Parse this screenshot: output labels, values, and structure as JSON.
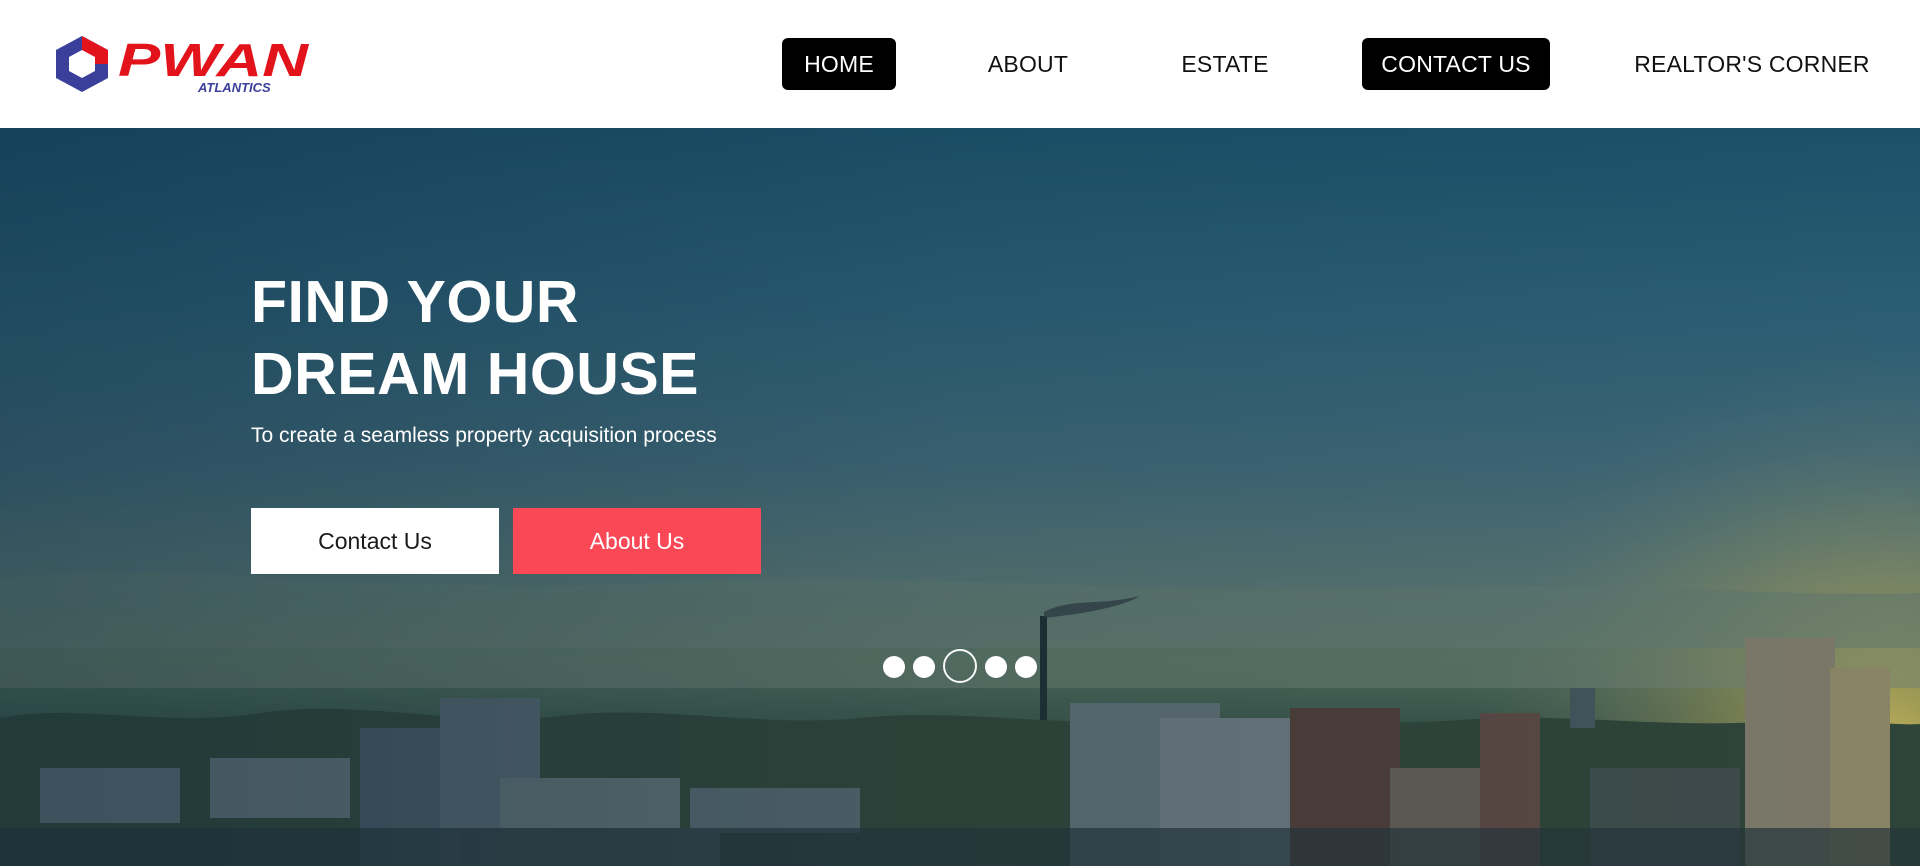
{
  "header": {
    "logo": {
      "primary_text": "PWAN",
      "secondary_text": "ATLANTICS",
      "icon": "hexagon-logo-icon",
      "colors": {
        "red": "#e3131b",
        "blue": "#3a3f99"
      }
    },
    "nav": [
      {
        "label": "HOME",
        "active": true
      },
      {
        "label": "ABOUT",
        "active": false
      },
      {
        "label": "ESTATE",
        "active": false
      },
      {
        "label": "CONTACT US",
        "active": true
      },
      {
        "label": "REALTOR'S CORNER",
        "active": false
      }
    ]
  },
  "hero": {
    "title_line1": "FIND YOUR",
    "title_line2": "DREAM HOUSE",
    "subtitle": "To create a seamless property acquisition process",
    "buttons": {
      "contact_label": "Contact Us",
      "about_label": "About Us"
    },
    "slider": {
      "count": 5,
      "active_index": 2
    },
    "colors": {
      "accent": "#fb4857",
      "nav_active_bg": "#000000"
    },
    "background": "city-skyline-image"
  }
}
